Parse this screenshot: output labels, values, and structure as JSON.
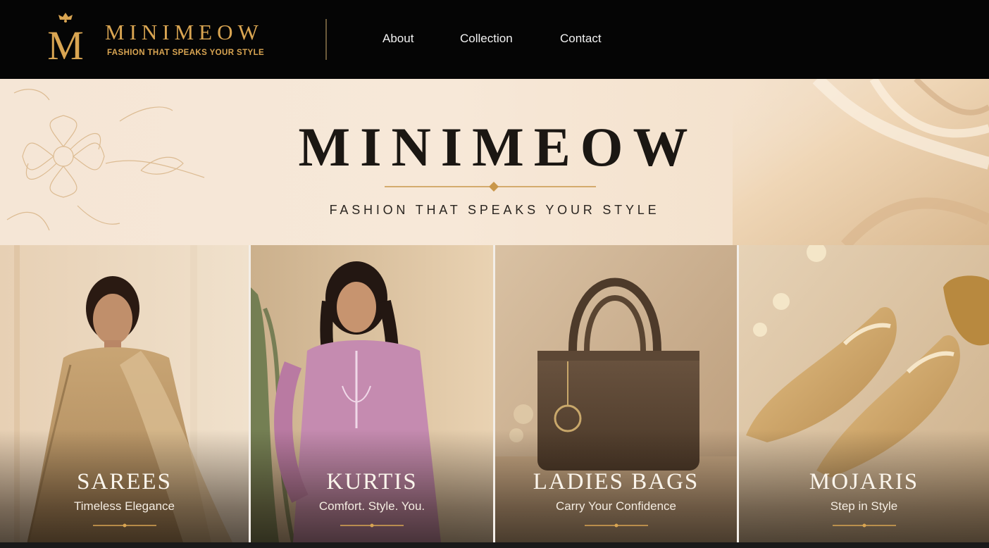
{
  "brand": {
    "logo_letter": "M",
    "name": "MINIMEOW",
    "tagline": "FASHION THAT SPEAKS YOUR STYLE"
  },
  "nav": {
    "links": [
      {
        "label": "About"
      },
      {
        "label": "Collection"
      },
      {
        "label": "Contact"
      }
    ]
  },
  "hero": {
    "title": "MINIMEOW",
    "tagline": "FASHION THAT SPEAKS YOUR STYLE"
  },
  "categories": [
    {
      "title": "SAREES",
      "subtitle": "Timeless Elegance"
    },
    {
      "title": "KURTIS",
      "subtitle": "Comfort. Style. You."
    },
    {
      "title": "LADIES BAGS",
      "subtitle": "Carry Your Confidence"
    },
    {
      "title": "MOJARIS",
      "subtitle": "Step in Style"
    }
  ],
  "colors": {
    "gold": "#d9a552",
    "nav_bg": "#050505",
    "hero_bg": "#f5e6d6",
    "title_dark": "#1b1713"
  }
}
